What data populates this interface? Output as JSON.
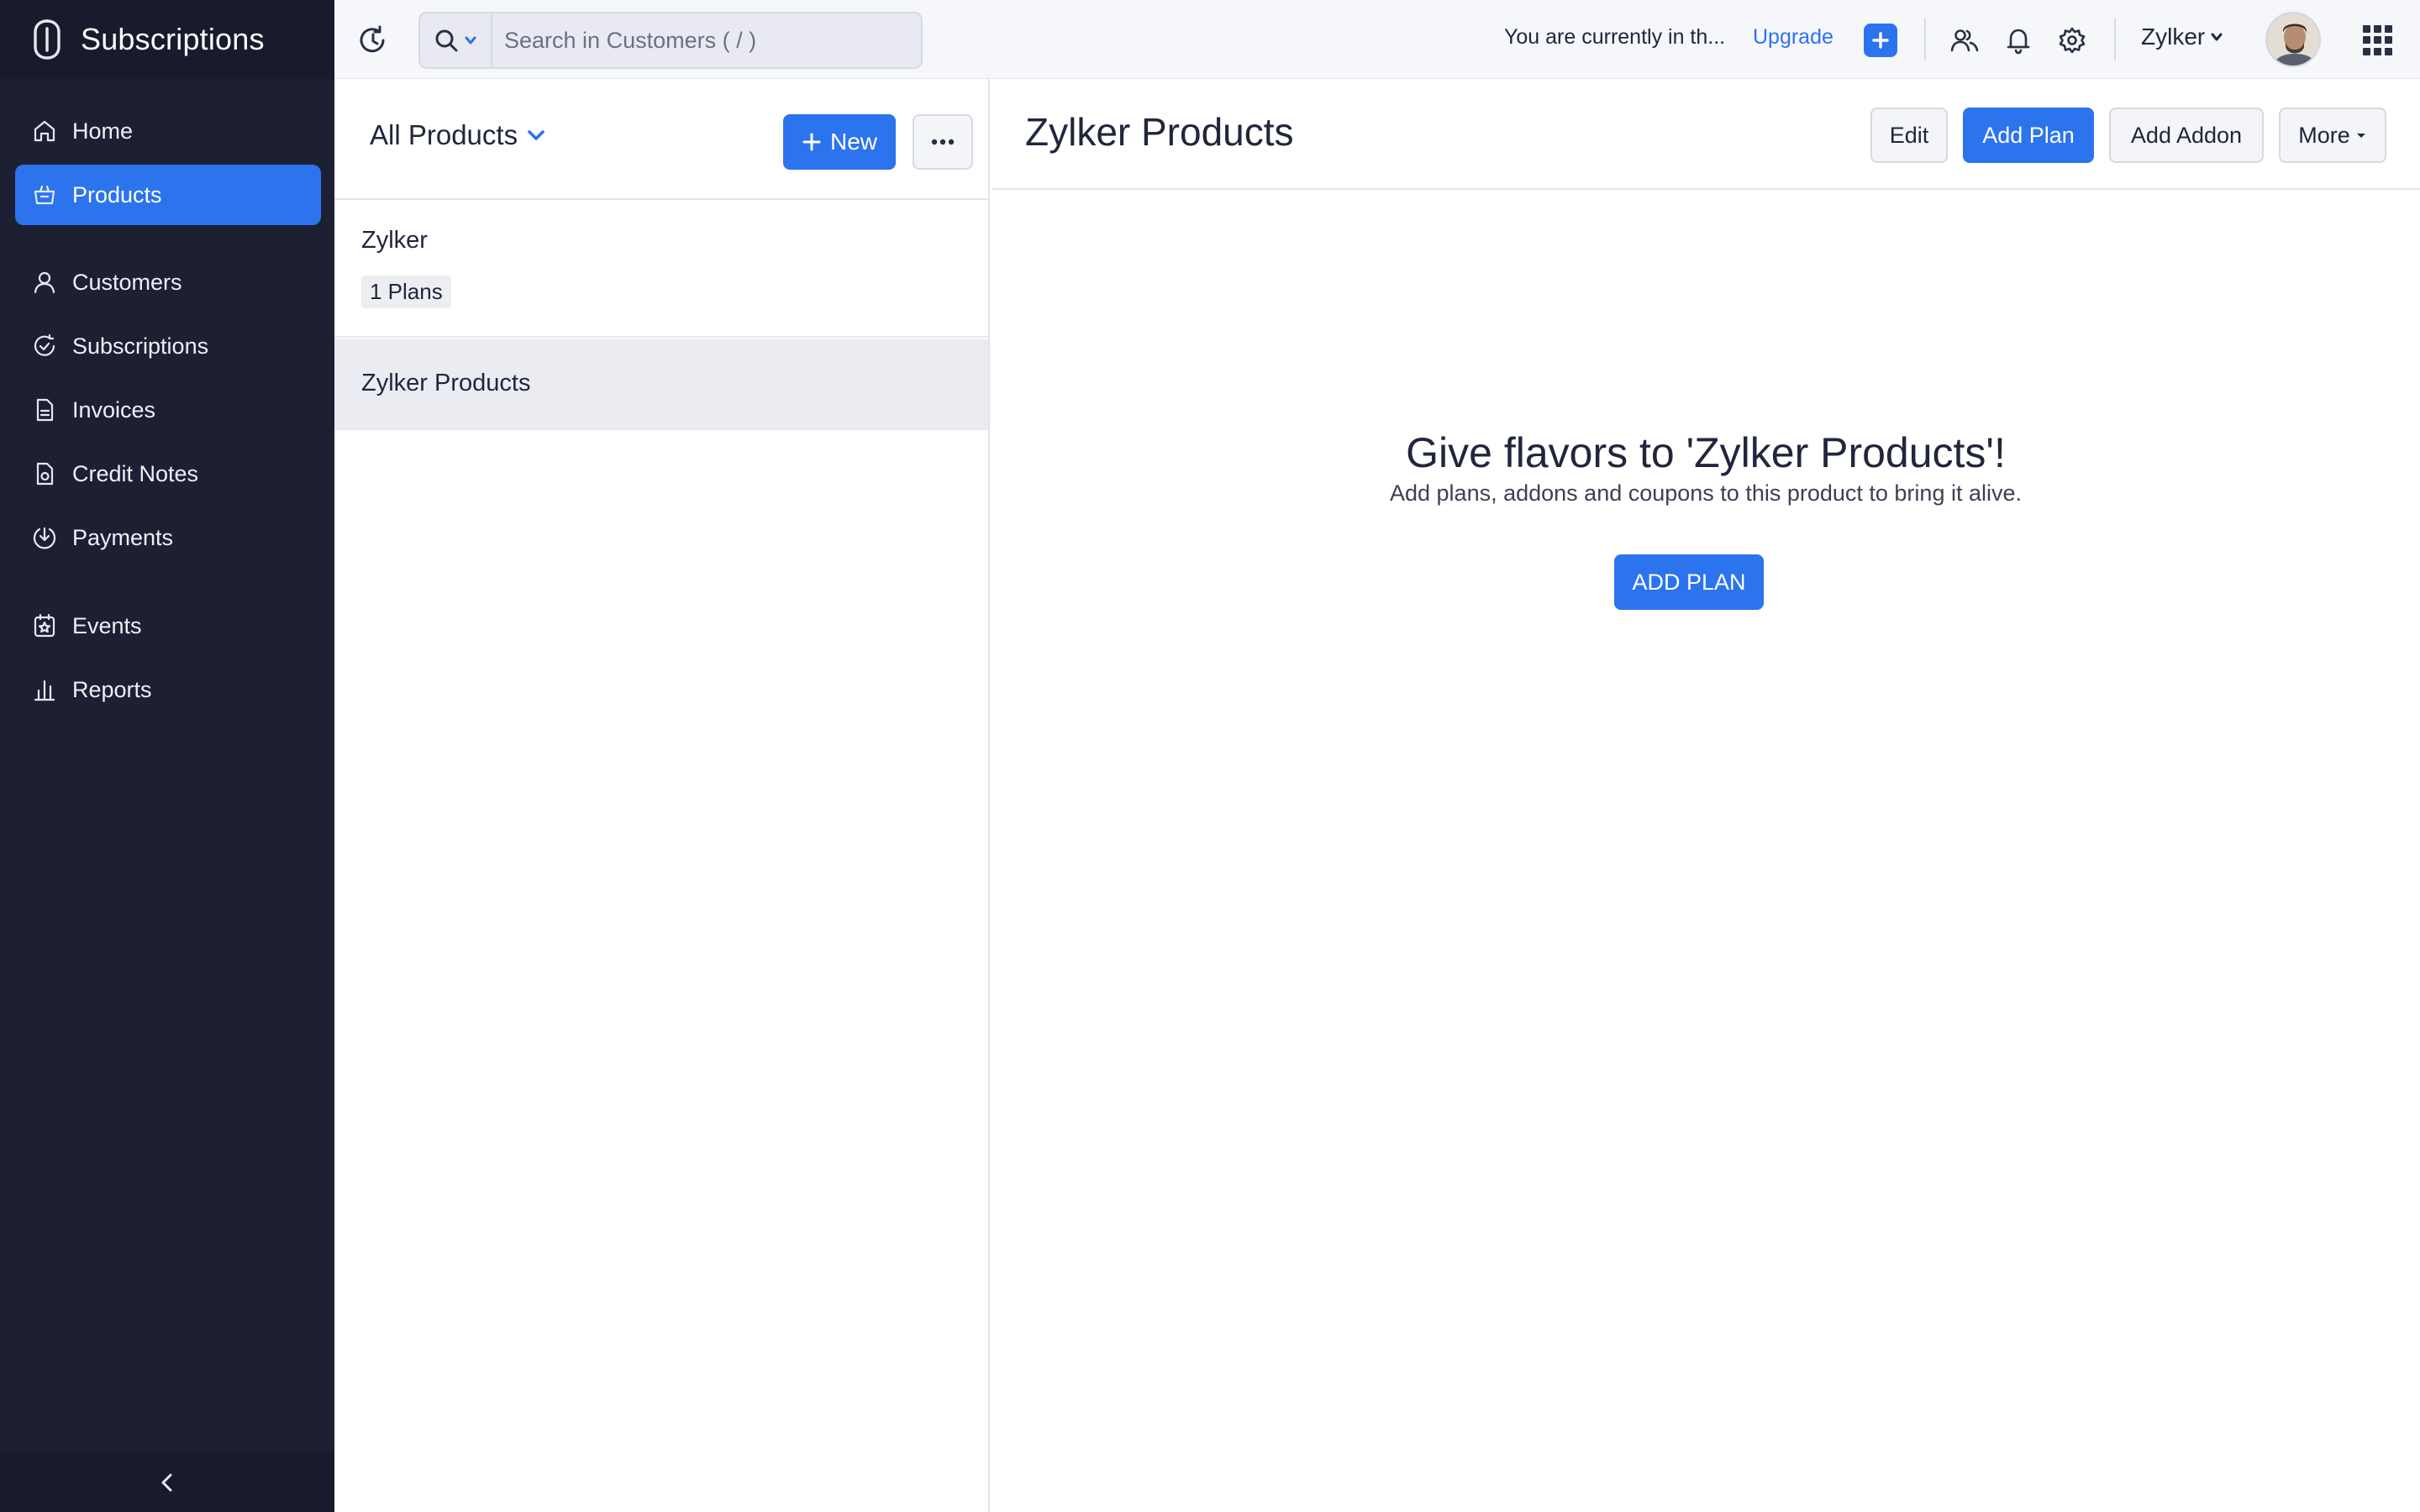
{
  "app": {
    "name": "Subscriptions",
    "accent_color": "#2c73ee",
    "sidebar_color": "#1d2033"
  },
  "sidebar": {
    "items": [
      {
        "label": "Home",
        "icon": "home-icon",
        "active": false
      },
      {
        "label": "Products",
        "icon": "basket-icon",
        "active": true
      },
      {
        "label": "Customers",
        "icon": "user-icon",
        "active": false
      },
      {
        "label": "Subscriptions",
        "icon": "subscription-cycle-icon",
        "active": false
      },
      {
        "label": "Invoices",
        "icon": "document-icon",
        "active": false
      },
      {
        "label": "Credit Notes",
        "icon": "credit-note-icon",
        "active": false
      },
      {
        "label": "Payments",
        "icon": "payment-download-icon",
        "active": false
      },
      {
        "label": "Events",
        "icon": "events-calendar-icon",
        "active": false
      },
      {
        "label": "Reports",
        "icon": "bar-chart-icon",
        "active": false
      }
    ],
    "collapse_icon": "chevron-left-icon"
  },
  "topbar": {
    "search_placeholder": "Search in Customers ( / )",
    "trial_text": "You are currently in th...",
    "upgrade_label": "Upgrade",
    "org_name": "Zylker"
  },
  "list": {
    "view_title": "All Products",
    "new_label": "New",
    "items": [
      {
        "name": "Zylker",
        "badge": "1 Plans",
        "selected": false
      },
      {
        "name": "Zylker Products",
        "badge": "",
        "selected": true
      }
    ]
  },
  "detail": {
    "title": "Zylker Products",
    "edit_label": "Edit",
    "add_plan_label": "Add Plan",
    "add_addon_label": "Add Addon",
    "more_label": "More",
    "empty_title": "Give flavors to 'Zylker Products'!",
    "empty_subtitle": "Add plans, addons and coupons to this product to bring it alive.",
    "empty_cta": "ADD PLAN"
  }
}
